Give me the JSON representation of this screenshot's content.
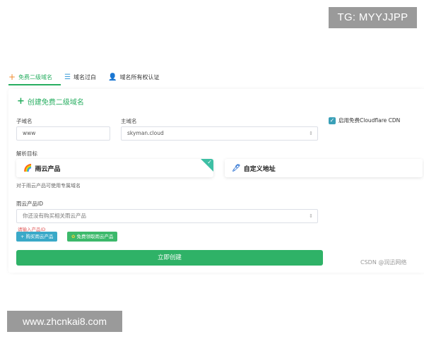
{
  "badges": {
    "telegram": "TG: MYYJJPP",
    "site": "www.zhcnkai8.com"
  },
  "tabs": [
    {
      "label": "免费二级域名",
      "icon": "plus-icon",
      "active": true
    },
    {
      "label": "域名过白",
      "icon": "list-icon",
      "active": false
    },
    {
      "label": "域名所有权认证",
      "icon": "user-icon",
      "active": false
    }
  ],
  "form": {
    "title": "创建免费二级域名",
    "subdomain_label": "子域名",
    "subdomain_value": "www",
    "main_domain_label": "主域名",
    "main_domain_value": "skyman.cloud",
    "cdn_label": "启用免费Cloudflare CDN",
    "cdn_checked": true,
    "target_label": "解析目标",
    "option_rain": "雨云产品",
    "option_custom": "自定义地址",
    "target_hint": "对于雨云产品可使用专属域名",
    "product_id_label": "雨云产品ID",
    "product_id_placeholder": "你还没有购买相关雨云产品",
    "product_id_error": "请输入产品ID",
    "buy_button": "购买雨云产品",
    "free_button": "免费领取雨云产品",
    "create_button": "立即创建"
  },
  "watermark": "CSDN @润迅网络",
  "colors": {
    "accent": "#27ae60",
    "info": "#3aa9c8",
    "error": "#e05a5a"
  }
}
